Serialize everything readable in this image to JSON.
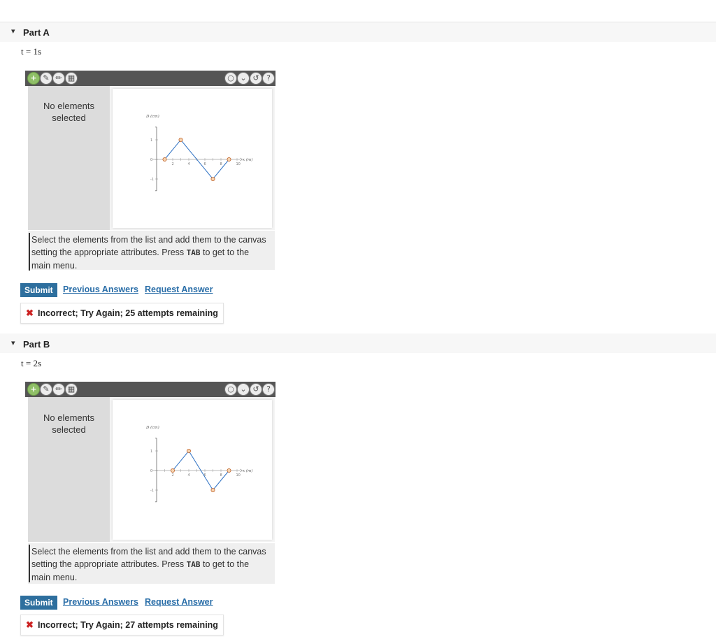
{
  "parts": [
    {
      "title": "Part A",
      "time_label": "t = 1s",
      "no_elements": "No elements selected",
      "instructions_pre": "Select the elements from the list and add them to the canvas setting the appropriate attributes. Press ",
      "instructions_key": "TAB",
      "instructions_post": " to get to the main menu.",
      "submit_label": "Submit",
      "previous_answers_label": "Previous Answers",
      "request_answer_label": "Request Answer",
      "feedback": "Incorrect; Try Again; 25 attempts remaining",
      "chart_data": {
        "type": "line",
        "ylabel": "D (cm)",
        "xlabel": "x (m)",
        "x_ticks": [
          "2",
          "4",
          "6",
          "8",
          "10"
        ],
        "y_ticks": [
          "1",
          "0",
          "-1"
        ],
        "points": [
          [
            1,
            0
          ],
          [
            3,
            1
          ],
          [
            7,
            -1
          ],
          [
            9,
            0
          ]
        ]
      }
    },
    {
      "title": "Part B",
      "time_label": "t = 2s",
      "no_elements": "No elements selected",
      "instructions_pre": "Select the elements from the list and add them to the canvas setting the appropriate attributes. Press ",
      "instructions_key": "TAB",
      "instructions_post": " to get to the main menu.",
      "submit_label": "Submit",
      "previous_answers_label": "Previous Answers",
      "request_answer_label": "Request Answer",
      "feedback": "Incorrect; Try Again; 27 attempts remaining",
      "chart_data": {
        "type": "line",
        "ylabel": "D (cm)",
        "xlabel": "x (m)",
        "x_ticks": [
          "2",
          "4",
          "6",
          "8",
          "10"
        ],
        "y_ticks": [
          "1",
          "0",
          "-1"
        ],
        "points": [
          [
            2,
            0
          ],
          [
            4,
            1
          ],
          [
            7,
            -1
          ],
          [
            9,
            0
          ]
        ]
      }
    }
  ],
  "toolbar_left_icons": [
    "plus-icon",
    "pencil-icon",
    "edit-icon",
    "trash-icon"
  ],
  "toolbar_right_icons": [
    "hint-bulb-icon",
    "chevron-down-icon",
    "reset-icon",
    "help-icon"
  ]
}
